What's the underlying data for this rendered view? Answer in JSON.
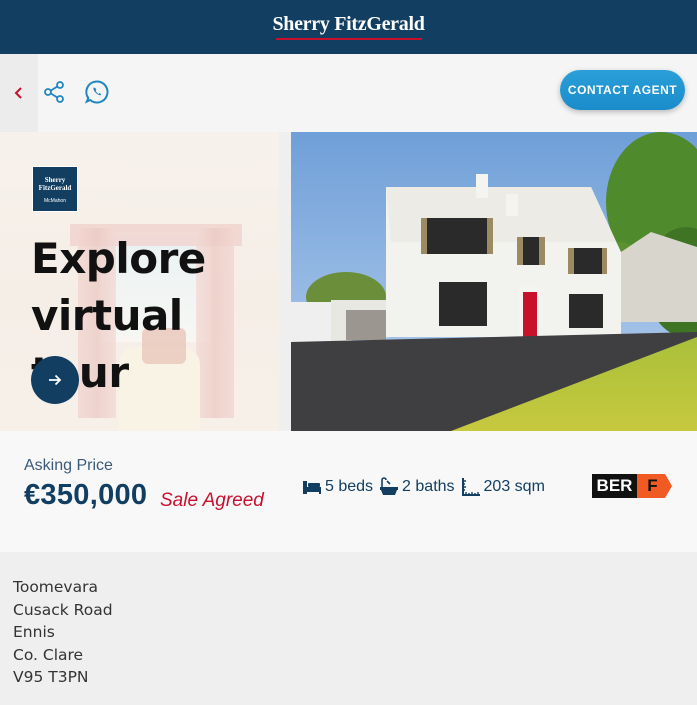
{
  "header": {
    "brand": "Sherry FitzGerald"
  },
  "toolbar": {
    "back_icon": "chevron-left-icon",
    "share_icon": "share-icon",
    "whatsapp_icon": "whatsapp-icon",
    "contact_label": "CONTACT AGENT"
  },
  "tour": {
    "logo_line1": "Sherry",
    "logo_line2": "FitzGerald",
    "logo_sub": "McMahon",
    "title_line1": "Explore",
    "title_line2": "virtual tour",
    "arrow_icon": "arrow-right-icon"
  },
  "listing": {
    "asking_label": "Asking Price",
    "price": "€350,000",
    "status": "Sale Agreed",
    "beds": "5 beds",
    "baths": "2 baths",
    "area": "203 sqm",
    "ber_label": "BER",
    "ber_grade": "F"
  },
  "address": {
    "lines": [
      "Toomevara",
      "Cusack Road",
      "Ennis",
      "Co. Clare",
      "V95 T3PN"
    ]
  },
  "colors": {
    "navy": "#123e62",
    "red": "#c8102e",
    "contact_blue": "#1a8ccb",
    "ber_orange": "#f15a22"
  }
}
